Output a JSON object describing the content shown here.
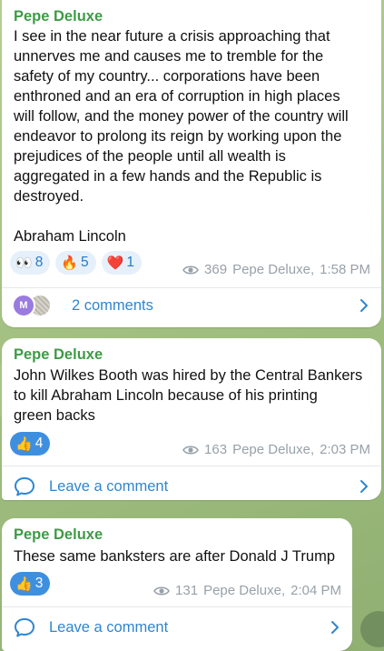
{
  "messages": [
    {
      "sender": "Pepe Deluxe",
      "text": "I see in the near future a crisis approaching that\nunnerves me and causes me to tremble for the\nsafety of my country... corporations have been\nenthroned and an era of corruption in high places\nwill follow, and the money power of the country will\nendeavor to prolong its reign by working upon the\nprejudices of the people until all wealth is\naggregated in a few hands and the Republic is\ndestroyed.\n\nAbraham Lincoln",
      "reactions": [
        {
          "emoji": "👀",
          "count": "8"
        },
        {
          "emoji": "🔥",
          "count": "5"
        },
        {
          "emoji": "❤️",
          "count": "1"
        }
      ],
      "views": "369",
      "author": "Pepe Deluxe,",
      "time": "1:58 PM",
      "footer": {
        "avatar_initial": "M",
        "label": "2 comments"
      }
    },
    {
      "sender": "Pepe Deluxe",
      "text": "John Wilkes Booth was hired by the Central Bankers\nto kill Abraham Lincoln because of his printing\ngreen backs",
      "reactions": [
        {
          "emoji": "👍",
          "count": "4"
        }
      ],
      "views": "163",
      "author": "Pepe Deluxe,",
      "time": "2:03 PM",
      "footer": {
        "label": "Leave a comment"
      }
    },
    {
      "sender": "Pepe Deluxe",
      "text": "These same banksters are after Donald J Trump",
      "reactions": [
        {
          "emoji": "👍",
          "count": "3"
        }
      ],
      "views": "131",
      "author": "Pepe Deluxe,",
      "time": "2:04 PM",
      "footer": {
        "label": "Leave a comment"
      }
    }
  ],
  "colors": {
    "sender": "#3e9b46",
    "link": "#2f86d0",
    "meta": "#98a1a9",
    "reaction_bg": "#e6f0fb",
    "reaction_selected_bg": "#3f8fe0"
  },
  "icons": {
    "views": "eye-icon",
    "comment": "comment-bubble-icon",
    "chevron": "chevron-right-icon"
  }
}
